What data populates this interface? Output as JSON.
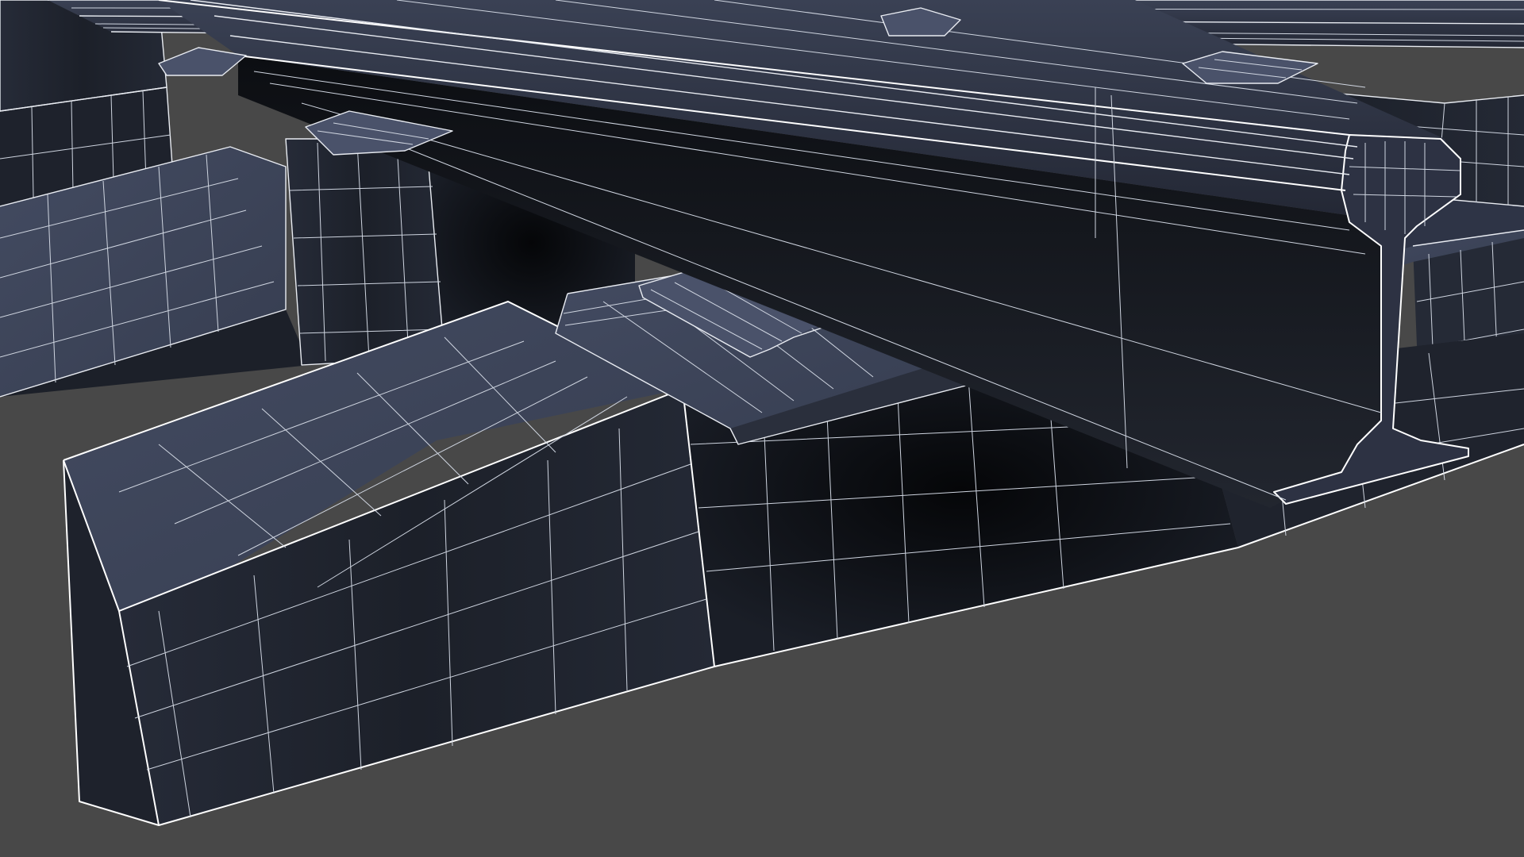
{
  "viewport": {
    "background_color": "#484848",
    "mesh_colors": {
      "top_face": "#3d4458",
      "side_face": "#20242f",
      "shadow_face": "#0d0f14",
      "rail_face": "#2c3140",
      "wireframe": "#e9ecf2"
    },
    "shading_mode": "wireframe-on-shaded"
  },
  "scene": {
    "objects": [
      {
        "name": "rail"
      },
      {
        "name": "sleeper"
      },
      {
        "name": "tie-plate"
      },
      {
        "name": "rail-clip"
      }
    ]
  }
}
